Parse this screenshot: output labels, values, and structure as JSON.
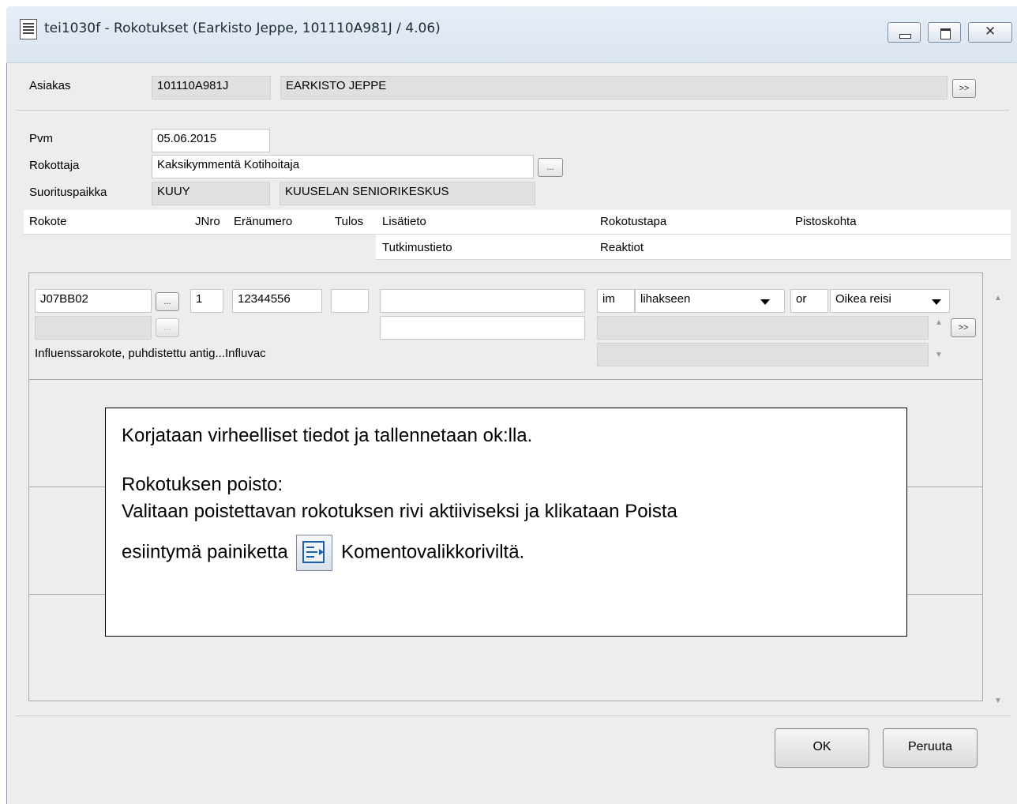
{
  "window": {
    "title": "tei1030f - Rokotukset    (Earkisto Jeppe, 101110A981J / 4.06)"
  },
  "customer": {
    "label": "Asiakas",
    "id": "101110A981J",
    "name": "EARKISTO JEPPE",
    "more_button": ">>"
  },
  "form": {
    "pvm_label": "Pvm",
    "pvm_value": "05.06.2015",
    "rokottaja_label": "Rokottaja",
    "rokottaja_value": "Kaksikymmentä Kotihoitaja",
    "ellipsis": "...",
    "suorituspaikka_label": "Suorituspaikka",
    "suorituspaikka_code": "KUUY",
    "suorituspaikka_name": "KUUSELAN SENIORIKESKUS"
  },
  "table_header": {
    "rokote": "Rokote",
    "jnro": "JNro",
    "eranumero": "Eränumero",
    "tulos": "Tulos",
    "lisatieto": "Lisätieto",
    "rokotustapa": "Rokotustapa",
    "pistoskohta": "Pistoskohta",
    "tutkimustieto": "Tutkimustieto",
    "reaktiot": "Reaktiot"
  },
  "row": {
    "rokote_code": "J07BB02",
    "jnro": "1",
    "eranumero": "12344556",
    "tulos": "",
    "lisatieto": "",
    "rokotustapa_code": "im",
    "rokotustapa_text": "lihakseen",
    "pistoskohta_code": "or",
    "pistoskohta_text": "Oikea reisi",
    "vaccine_description": "Influenssarokote, puhdistettu antig...Influvac",
    "more_button": ">>"
  },
  "note": {
    "line1": "Korjataan virheelliset tiedot ja tallennetaan ok:lla.",
    "line2": "Rokotuksen poisto:",
    "line3": "Valitaan poistettavan rokotuksen rivi aktiiviseksi ja klikataan Poista",
    "line4_a": "esiintymä painiketta",
    "line4_b": "Komentovalikkoriviltä."
  },
  "buttons": {
    "ok": "OK",
    "cancel": "Peruuta"
  },
  "icons": {
    "window_icon": "document-icon",
    "remove_instance_icon": "remove-occurrence-icon"
  }
}
